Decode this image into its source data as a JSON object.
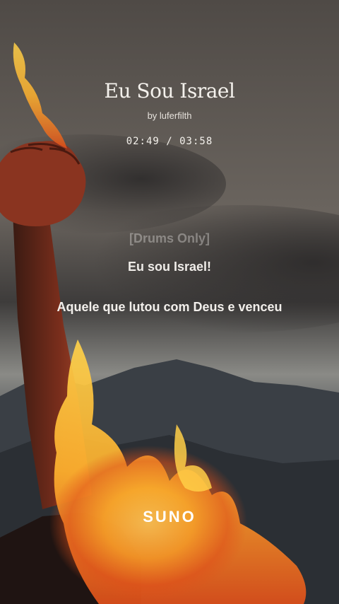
{
  "song": {
    "title": "Eu Sou Israel",
    "artist": "by luferfilth",
    "time_display": "02:49 / 03:58"
  },
  "lyrics": {
    "section_tag": "[Drums Only]",
    "line1": "Eu sou Israel!",
    "line2": "Aquele que lutou com Deus e venceu"
  },
  "brand": {
    "logo_text": "SUNO"
  },
  "icons": [
    "raised-fist-image",
    "fire-image",
    "mountains-image"
  ],
  "colors": {
    "sky": "#5a5550",
    "flame_core": "#ffd24a",
    "flame_edge": "#e0501a",
    "mountain": "#2f3338"
  }
}
